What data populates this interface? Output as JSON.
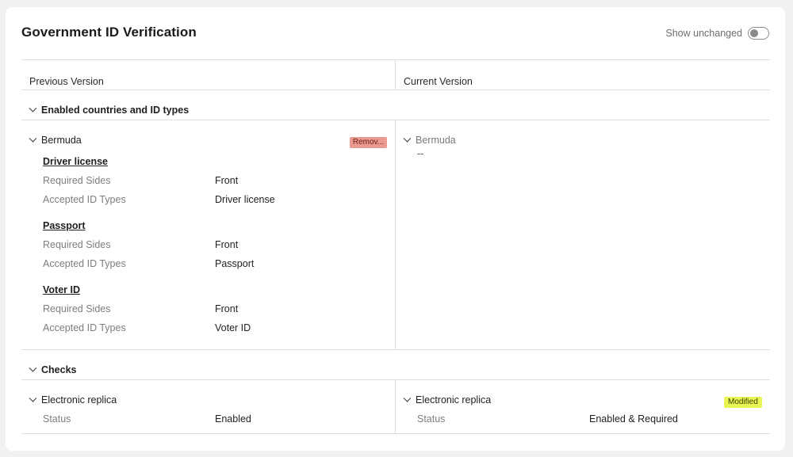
{
  "title": "Government ID Verification",
  "toggle": {
    "label": "Show unchanged",
    "on": false
  },
  "columns": {
    "previous": "Previous Version",
    "current": "Current Version"
  },
  "sections": {
    "countries": {
      "title": "Enabled countries and ID types",
      "previous": {
        "country": "Bermuda",
        "badge": "Remov...",
        "badge_color": "#ea9a8e",
        "id_types": [
          {
            "name": "Driver license",
            "required_sides_label": "Required Sides",
            "required_sides": "Front",
            "accepted_label": "Accepted ID Types",
            "accepted": "Driver license"
          },
          {
            "name": "Passport",
            "required_sides_label": "Required Sides",
            "required_sides": "Front",
            "accepted_label": "Accepted ID Types",
            "accepted": "Passport"
          },
          {
            "name": "Voter ID",
            "required_sides_label": "Required Sides",
            "required_sides": "Front",
            "accepted_label": "Accepted ID Types",
            "accepted": "Voter ID"
          }
        ]
      },
      "current": {
        "country": "Bermuda",
        "value": "--"
      }
    },
    "checks": {
      "title": "Checks",
      "previous": {
        "name": "Electronic replica",
        "status_label": "Status",
        "status": "Enabled"
      },
      "current": {
        "name": "Electronic replica",
        "badge": "Modified",
        "badge_color": "#e8f553",
        "status_label": "Status",
        "status": "Enabled & Required"
      }
    }
  }
}
